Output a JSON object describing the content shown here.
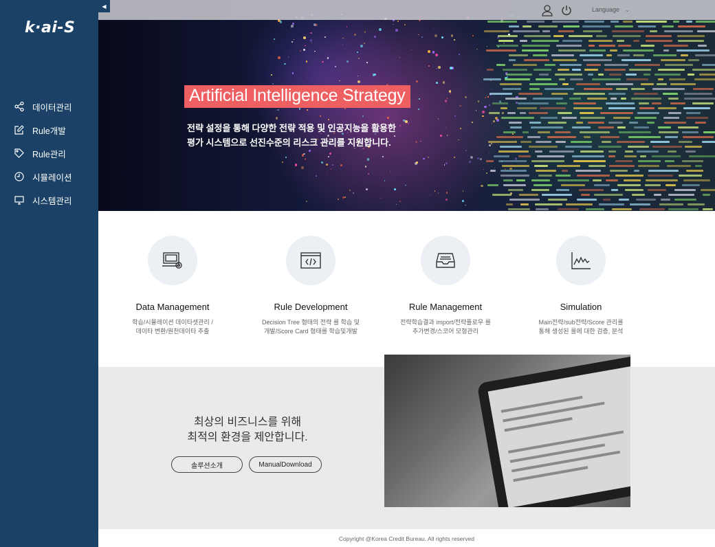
{
  "app": {
    "logo_text": "k·ai-S",
    "collapse_icon": "caret-left-icon"
  },
  "sidebar": {
    "items": [
      {
        "label": "데이터관리",
        "icon": "share-icon"
      },
      {
        "label": "Rule개발",
        "icon": "edit-icon"
      },
      {
        "label": "Rule관리",
        "icon": "tag-icon"
      },
      {
        "label": "시뮬레이션",
        "icon": "clock-icon"
      },
      {
        "label": "시스템관리",
        "icon": "monitor-icon"
      }
    ]
  },
  "topbar": {
    "language_label": "Language",
    "icons": [
      "user-icon",
      "power-icon",
      "chevron-down-icon"
    ]
  },
  "hero": {
    "title": "Artificial Intelligence Strategy",
    "desc_line1": "전략 설정을 통해 다양한 전략 적용 및 인공지능을 활용한",
    "desc_line2": "평가 시스템으로 선진수준의 리스크 관리를 지원합니다."
  },
  "features": [
    {
      "title": "Data Management",
      "desc_line1": "학습/시뮬레이션 데이타셋관리 /",
      "desc_line2": "데이타 변환/원천데이타 추출",
      "icon": "computer-gear-icon"
    },
    {
      "title": "Rule Development",
      "desc_line1": "Decision Tree 형태의 전략 를 학습 및",
      "desc_line2": "개발/Score Card 형태를 학습및개발",
      "icon": "code-window-icon"
    },
    {
      "title": "Rule Management",
      "desc_line1": "전략학습결과 import/전략플로우 를",
      "desc_line2": "추가변경/스코어 모형관리",
      "icon": "inbox-icon"
    },
    {
      "title": "Simulation",
      "desc_line1": "Main전략/sub전략/Score 관리를",
      "desc_line2": "통해 생성된 룰에 대한 검증, 분석",
      "icon": "line-chart-icon"
    }
  ],
  "cta": {
    "line1": "최상의 비즈니스를 위해",
    "line2": "최적의 환경을 제안합니다.",
    "solution_button": "솔루션소개",
    "manual_button": "ManualDownload"
  },
  "footer": {
    "copyright": "Copyright @Korea Credit Bureau. All rights reserved"
  },
  "colors": {
    "sidebar": "#1b4266",
    "accent": "#ee5f62",
    "band": "#e8eaec"
  }
}
